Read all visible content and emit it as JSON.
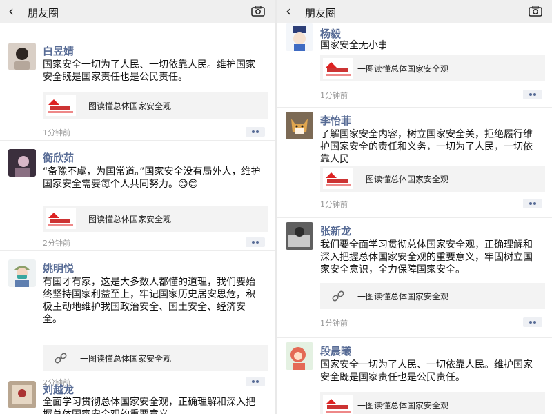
{
  "left": {
    "header": {
      "title": "朋友圈"
    },
    "posts": [
      {
        "name": "白昱婧",
        "text": "国家安全一切为了人民、一切依靠人民。维护国家安全既是国家责任也是公民责任。",
        "link": "一图读懂总体国家安全观",
        "time": "1分钟前"
      },
      {
        "name": "衡欣茹",
        "text": "“备豫不虞，为国常道。”国家安全没有局外人，维护国家安全需要每个人共同努力。😊😊",
        "link": "一图读懂总体国家安全观",
        "time": "2分钟前"
      },
      {
        "name": "姚明悦",
        "text": "有国才有家，这是大多数人都懂的道理，我们要始终坚持国家利益至上，牢记国家历史居安思危，积极主动地维护我国政治安全、国土安全、经济安全。",
        "link": "一图读懂总体国家安全观",
        "time": "2分钟前"
      },
      {
        "name": "刘越龙",
        "text": "全面学习贯彻总体国家安全观，正确理解和深入把握总体国家安全观的重要意义"
      }
    ]
  },
  "right": {
    "header": {
      "title": "朋友圈"
    },
    "posts": [
      {
        "name": "杨毅",
        "text": "国家安全无小事",
        "link": "一图读懂总体国家安全观",
        "time": "1分钟前"
      },
      {
        "name": "李怡菲",
        "text": "了解国家安全内容，树立国家安全关，拒绝履行维护国家安全的责任和义务，一切为了人民，一切依靠人民",
        "link": "一图读懂总体国家安全观",
        "time": "1分钟前"
      },
      {
        "name": "张新龙",
        "text": "我们要全面学习贯彻总体国家安全观，正确理解和深入把握总体国家安全观的重要意义，牢固树立国家安全意识，全力保障国家安全。",
        "link": "一图读懂总体国家安全观",
        "time": "1分钟前"
      },
      {
        "name": "段晨曦",
        "text": "国家安全一切为了人民、一切依靠人民。维护国家安全既是国家责任也是公民责任。",
        "link": "一图读懂总体国家安全观"
      }
    ]
  }
}
